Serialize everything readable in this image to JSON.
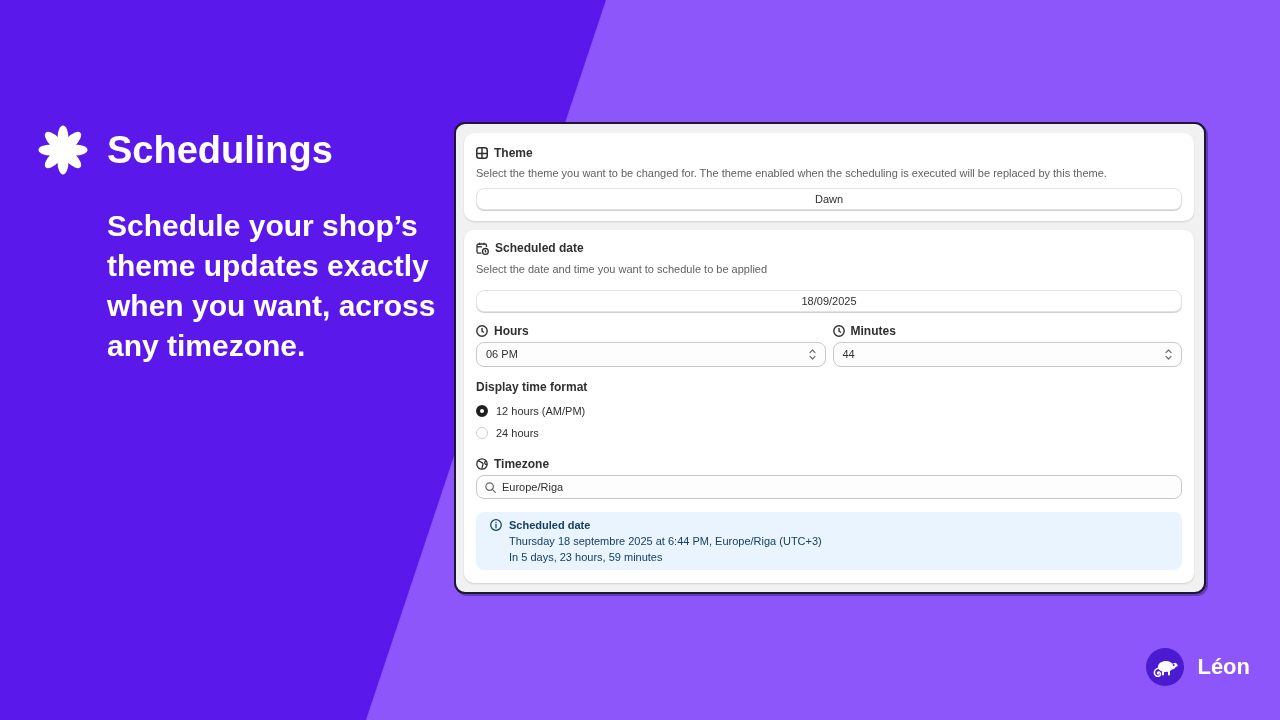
{
  "hero": {
    "title": "Schedulings",
    "subtitle": "Schedule your shop’s theme updates exactly when you want, across any timezone."
  },
  "theme_card": {
    "title": "Theme",
    "description": "Select the theme you want to be changed for. The theme enabled when the scheduling is executed will be replaced by this theme.",
    "select_value": "Dawn"
  },
  "schedule_card": {
    "title": "Scheduled date",
    "description": "Select the date and time you want to schedule to be applied",
    "date_value": "18/09/2025",
    "time_fields": [
      {
        "label": "Hours",
        "value": "06 PM"
      },
      {
        "label": "Minutes",
        "value": "44"
      }
    ],
    "time_format": {
      "label": "Display time format",
      "options": [
        {
          "label": "12 hours (AM/PM)",
          "selected": true
        },
        {
          "label": "24 hours",
          "selected": false
        }
      ]
    },
    "timezone": {
      "label": "Timezone",
      "value": "Europe/Riga"
    },
    "summary": {
      "title": "Scheduled date",
      "lines": [
        "Thursday 18 septembre 2025 at 6:44 PM, Europe/Riga (UTC+3)",
        "In 5 days, 23 hours, 59 minutes"
      ]
    }
  },
  "brand": {
    "name": "Léon"
  }
}
